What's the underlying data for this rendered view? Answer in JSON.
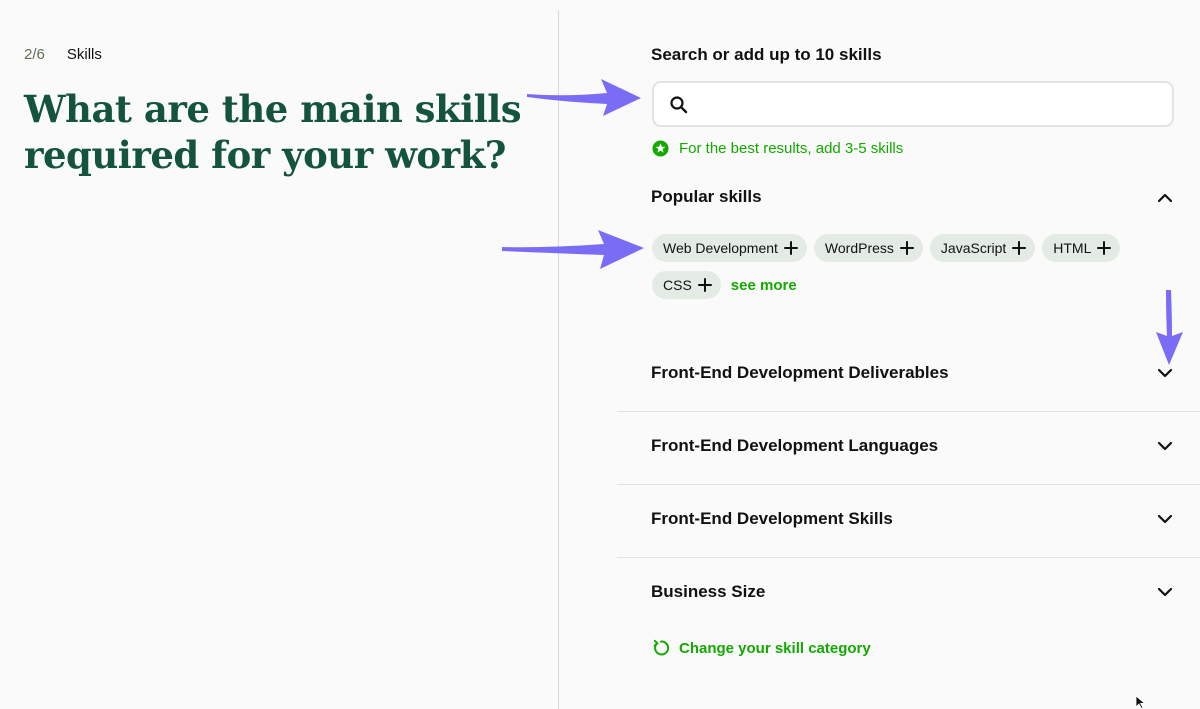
{
  "progress": {
    "step": "2/6",
    "section": "Skills"
  },
  "headline": "What are the main skills required for your work?",
  "search": {
    "label": "Search or add up to 10 skills",
    "value": "",
    "placeholder": "",
    "icon": "search-icon"
  },
  "hint": {
    "text": "For the best results, add 3-5 skills",
    "icon": "star-badge-icon"
  },
  "popular": {
    "title": "Popular skills",
    "expanded": true,
    "chips": [
      {
        "label": "Web Development"
      },
      {
        "label": "WordPress"
      },
      {
        "label": "JavaScript"
      },
      {
        "label": "HTML"
      },
      {
        "label": "CSS"
      }
    ],
    "see_more": "see more"
  },
  "accordions": [
    {
      "title": "Front-End Development Deliverables",
      "expanded": false
    },
    {
      "title": "Front-End Development Languages",
      "expanded": false
    },
    {
      "title": "Front-End Development Skills",
      "expanded": false
    },
    {
      "title": "Business Size",
      "expanded": false
    }
  ],
  "change_category": {
    "label": "Change your skill category",
    "icon": "refresh-icon"
  },
  "colors": {
    "headline": "#14543f",
    "accent_green": "#14a800",
    "chip_bg": "#e4ebe4",
    "annotation_arrow": "#7b6cf6"
  }
}
